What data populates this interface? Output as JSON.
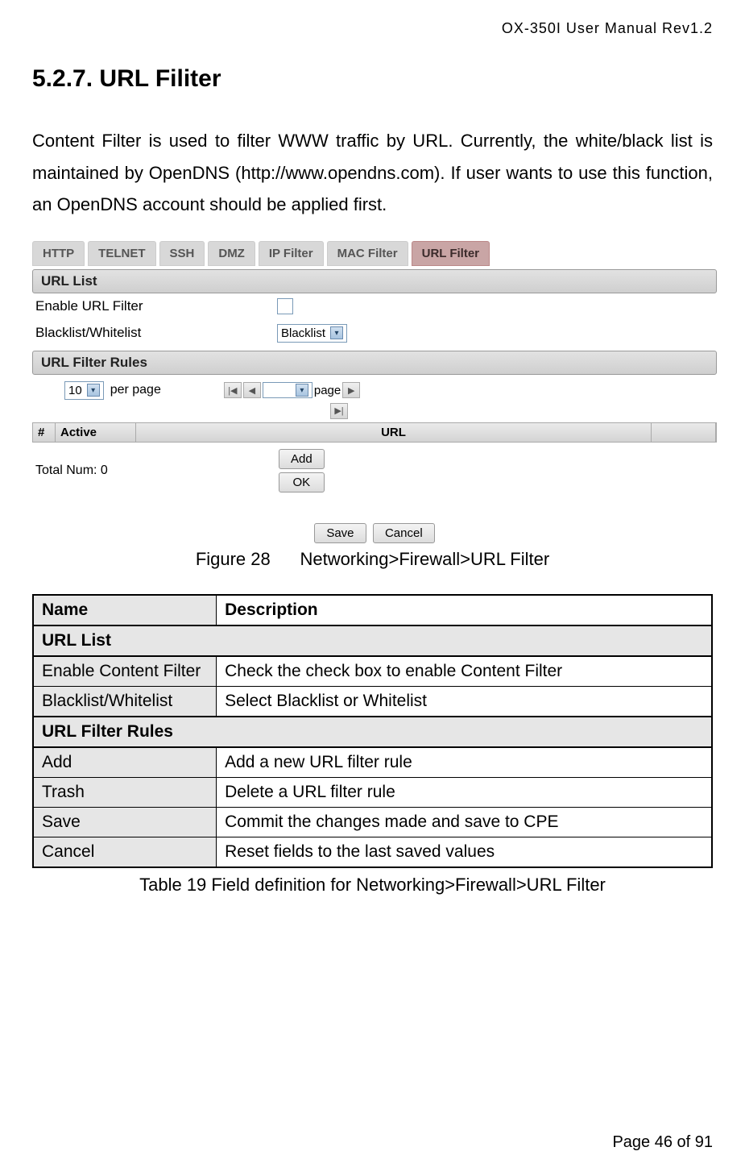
{
  "header": {
    "doc_id": "OX-350I  User  Manual  Rev1.2"
  },
  "section": {
    "number": "5.2.7.",
    "title": "URL Filiter"
  },
  "paragraph": "Content Filter is used to filter WWW traffic by URL. Currently, the white/black list is maintained by OpenDNS (http://www.opendns.com). If user wants to use this function, an OpenDNS account should be applied first.",
  "screenshot": {
    "tabs": [
      "HTTP",
      "TELNET",
      "SSH",
      "DMZ",
      "IP Filter",
      "MAC Filter",
      "URL Filter"
    ],
    "active_tab_index": 6,
    "bar1": "URL List",
    "row1_label": "Enable URL Filter",
    "row2_label": "Blacklist/Whitelist",
    "row2_value": "Blacklist",
    "bar2": "URL Filter Rules",
    "per_page_value": "10",
    "per_page_suffix": "per page",
    "page_label": "page",
    "grid": {
      "hash": "#",
      "active": "Active",
      "url": "URL"
    },
    "total": "Total Num: 0",
    "add_btn": "Add",
    "ok_btn": "OK",
    "save_btn": "Save",
    "cancel_btn": "Cancel"
  },
  "figure_caption": {
    "prefix": "Figure 28",
    "text": "Networking>Firewall>URL Filter"
  },
  "table": {
    "head": {
      "name": "Name",
      "desc": "Description"
    },
    "section1": "URL List",
    "rows1": [
      {
        "name": "Enable Content Filter",
        "desc": "Check the check box to enable Content Filter"
      },
      {
        "name": "Blacklist/Whitelist",
        "desc": "Select Blacklist or Whitelist"
      }
    ],
    "section2": "URL Filter Rules",
    "rows2": [
      {
        "name": "Add",
        "desc": "Add a new URL filter rule"
      },
      {
        "name": "Trash",
        "desc": "Delete a URL filter rule"
      },
      {
        "name": "Save",
        "desc": "Commit the changes made and save to CPE"
      },
      {
        "name": "Cancel",
        "desc": "Reset fields to the last saved values"
      }
    ]
  },
  "table_caption": "Table 19 Field definition for Networking>Firewall>URL Filter",
  "footer": "Page 46 of 91"
}
